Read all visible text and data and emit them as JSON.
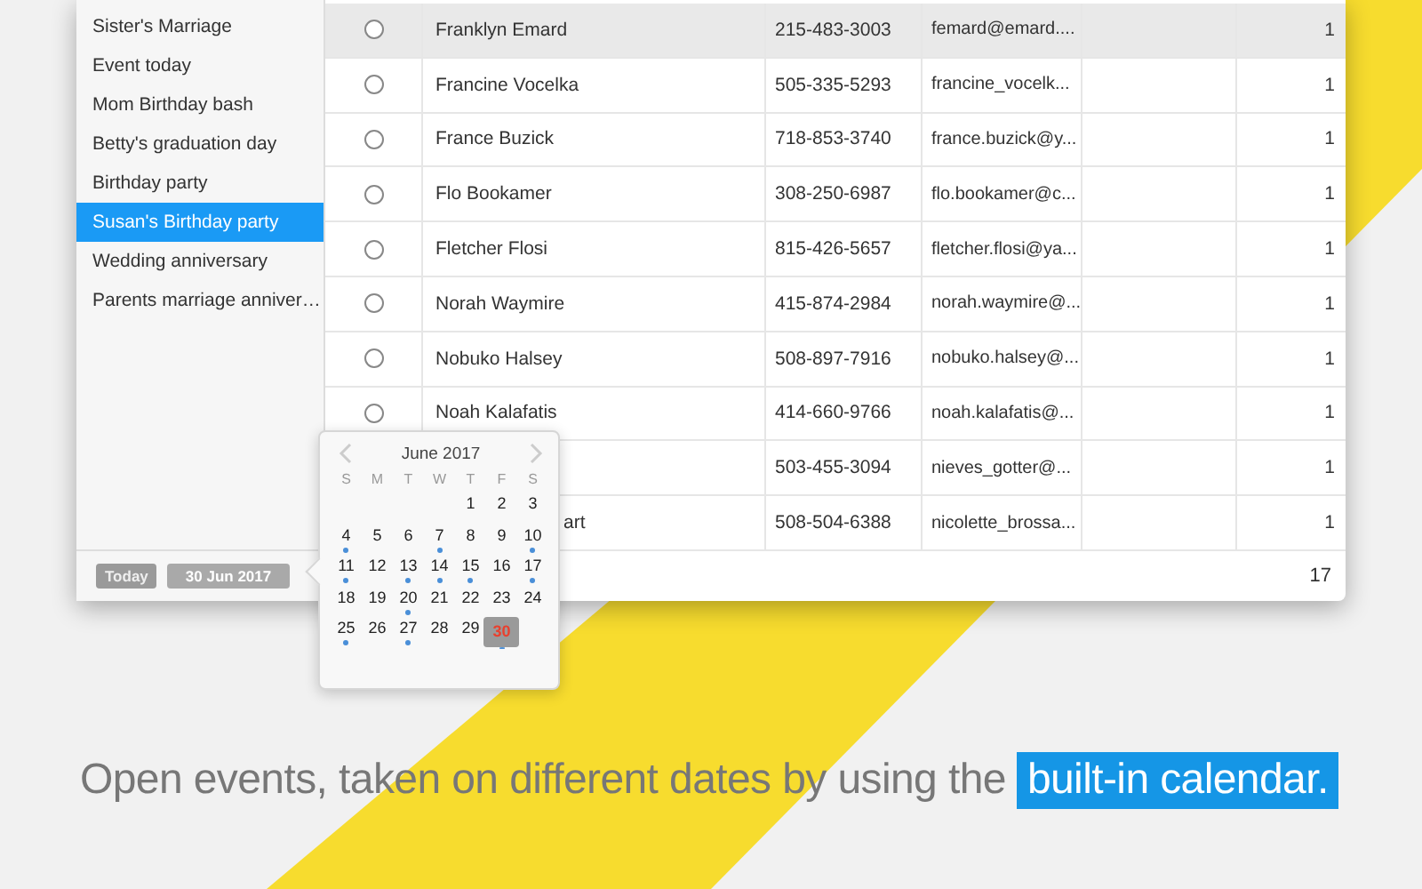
{
  "sidebar": {
    "items": [
      {
        "label": "Sister's Marriage",
        "selected": false
      },
      {
        "label": "Event today",
        "selected": false
      },
      {
        "label": "Mom Birthday bash",
        "selected": false
      },
      {
        "label": "Betty's graduation day",
        "selected": false
      },
      {
        "label": "Birthday party",
        "selected": false
      },
      {
        "label": "Susan's Birthday party",
        "selected": true
      },
      {
        "label": "Wedding anniversary",
        "selected": false
      },
      {
        "label": "Parents marriage anniver…",
        "selected": false
      }
    ],
    "today_button": "Today",
    "date_field": "30 Jun 2017"
  },
  "table": {
    "rows": [
      {
        "highlighted": true,
        "selected": false,
        "name": "Franklyn Emard",
        "phone": "215-483-3003",
        "email": "femard@emard....",
        "count": "1"
      },
      {
        "highlighted": false,
        "selected": false,
        "name": "Francine Vocelka",
        "phone": "505-335-5293",
        "email": "francine_vocelk...",
        "count": "1"
      },
      {
        "highlighted": false,
        "selected": false,
        "name": "France Buzick",
        "phone": "718-853-3740",
        "email": "france.buzick@y...",
        "count": "1"
      },
      {
        "highlighted": false,
        "selected": false,
        "name": "Flo Bookamer",
        "phone": "308-250-6987",
        "email": "flo.bookamer@c...",
        "count": "1"
      },
      {
        "highlighted": false,
        "selected": false,
        "name": "Fletcher Flosi",
        "phone": "815-426-5657",
        "email": "fletcher.flosi@ya...",
        "count": "1"
      },
      {
        "highlighted": false,
        "selected": false,
        "name": "Norah Waymire",
        "phone": "415-874-2984",
        "email": "norah.waymire@...",
        "count": "1"
      },
      {
        "highlighted": false,
        "selected": false,
        "name": "Nobuko Halsey",
        "phone": "508-897-7916",
        "email": "nobuko.halsey@...",
        "count": "1"
      },
      {
        "highlighted": false,
        "selected": false,
        "name": "Noah Kalafatis",
        "phone": "414-660-9766",
        "email": "noah.kalafatis@...",
        "count": "1"
      },
      {
        "highlighted": false,
        "phone": "503-455-3094",
        "email": "nieves_gotter@...",
        "count": "1"
      },
      {
        "highlighted": false,
        "name": "art",
        "name_cut": true,
        "phone": "508-504-6388",
        "email": "nicolette_brossa...",
        "count": "1"
      }
    ],
    "footer_count": "17"
  },
  "calendar": {
    "month": "June 2017",
    "weekdays": [
      "S",
      "M",
      "T",
      "W",
      "T",
      "F",
      "S"
    ],
    "days": [
      {
        "kind": "blank"
      },
      {
        "kind": "blank"
      },
      {
        "kind": "blank"
      },
      {
        "kind": "blank"
      },
      {
        "kind": "day",
        "label": "1",
        "event": false,
        "today": false
      },
      {
        "kind": "day",
        "label": "2",
        "event": false,
        "today": false
      },
      {
        "kind": "day",
        "label": "3",
        "event": false,
        "today": false
      },
      {
        "kind": "day",
        "label": "4",
        "event": true,
        "today": false
      },
      {
        "kind": "day",
        "label": "5",
        "event": false,
        "today": false
      },
      {
        "kind": "day",
        "label": "6",
        "event": false,
        "today": false
      },
      {
        "kind": "day",
        "label": "7",
        "event": true,
        "today": false
      },
      {
        "kind": "day",
        "label": "8",
        "event": false,
        "today": false
      },
      {
        "kind": "day",
        "label": "9",
        "event": false,
        "today": false
      },
      {
        "kind": "day",
        "label": "10",
        "event": true,
        "today": false
      },
      {
        "kind": "day",
        "label": "11",
        "event": true,
        "today": false
      },
      {
        "kind": "day",
        "label": "12",
        "event": false,
        "today": false
      },
      {
        "kind": "day",
        "label": "13",
        "event": true,
        "today": false
      },
      {
        "kind": "day",
        "label": "14",
        "event": true,
        "today": false
      },
      {
        "kind": "day",
        "label": "15",
        "event": true,
        "today": false
      },
      {
        "kind": "day",
        "label": "16",
        "event": false,
        "today": false
      },
      {
        "kind": "day",
        "label": "17",
        "event": true,
        "today": false
      },
      {
        "kind": "day",
        "label": "18",
        "event": false,
        "today": false
      },
      {
        "kind": "day",
        "label": "19",
        "event": false,
        "today": false
      },
      {
        "kind": "day",
        "label": "20",
        "event": true,
        "today": false
      },
      {
        "kind": "day",
        "label": "21",
        "event": false,
        "today": false
      },
      {
        "kind": "day",
        "label": "22",
        "event": false,
        "today": false
      },
      {
        "kind": "day",
        "label": "23",
        "event": false,
        "today": false
      },
      {
        "kind": "day",
        "label": "24",
        "event": false,
        "today": false
      },
      {
        "kind": "day",
        "label": "25",
        "event": true,
        "today": false
      },
      {
        "kind": "day",
        "label": "26",
        "event": false,
        "today": false
      },
      {
        "kind": "day",
        "label": "27",
        "event": true,
        "today": false
      },
      {
        "kind": "day",
        "label": "28",
        "event": false,
        "today": false
      },
      {
        "kind": "day",
        "label": "29",
        "event": false,
        "today": false
      },
      {
        "kind": "day",
        "label": "30",
        "event": true,
        "today": true
      }
    ]
  },
  "caption": {
    "text": "Open events, taken on different dates by using the",
    "highlight": "built-in calendar."
  }
}
